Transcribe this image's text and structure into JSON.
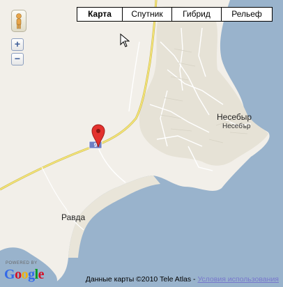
{
  "map_type": {
    "options": [
      "Карта",
      "Спутник",
      "Гибрид",
      "Рельеф"
    ],
    "selected": "Карта"
  },
  "places": {
    "nesebar": "Несебыр",
    "nesebar_old": "Несебър",
    "ravda": "Равда"
  },
  "zoom": {
    "in_label": "+",
    "out_label": "−"
  },
  "logo": {
    "powered_by": "POWERED BY",
    "letters": [
      "G",
      "o",
      "o",
      "g",
      "l",
      "e"
    ]
  },
  "footer": {
    "attribution": "Данные карты ©2010 Tele Atlas - ",
    "terms_link": "Условия использования"
  },
  "colors": {
    "sea": "#99b3cc",
    "land": "#f2efe9",
    "sand": "#e9e5d9",
    "road_major": "#f6e67a",
    "road_minor": "#ffffff",
    "marker": "#e3312d"
  },
  "icons": [
    "pegman-icon",
    "map-marker-icon",
    "cursor-icon",
    "zoom-in-icon",
    "zoom-out-icon"
  ]
}
